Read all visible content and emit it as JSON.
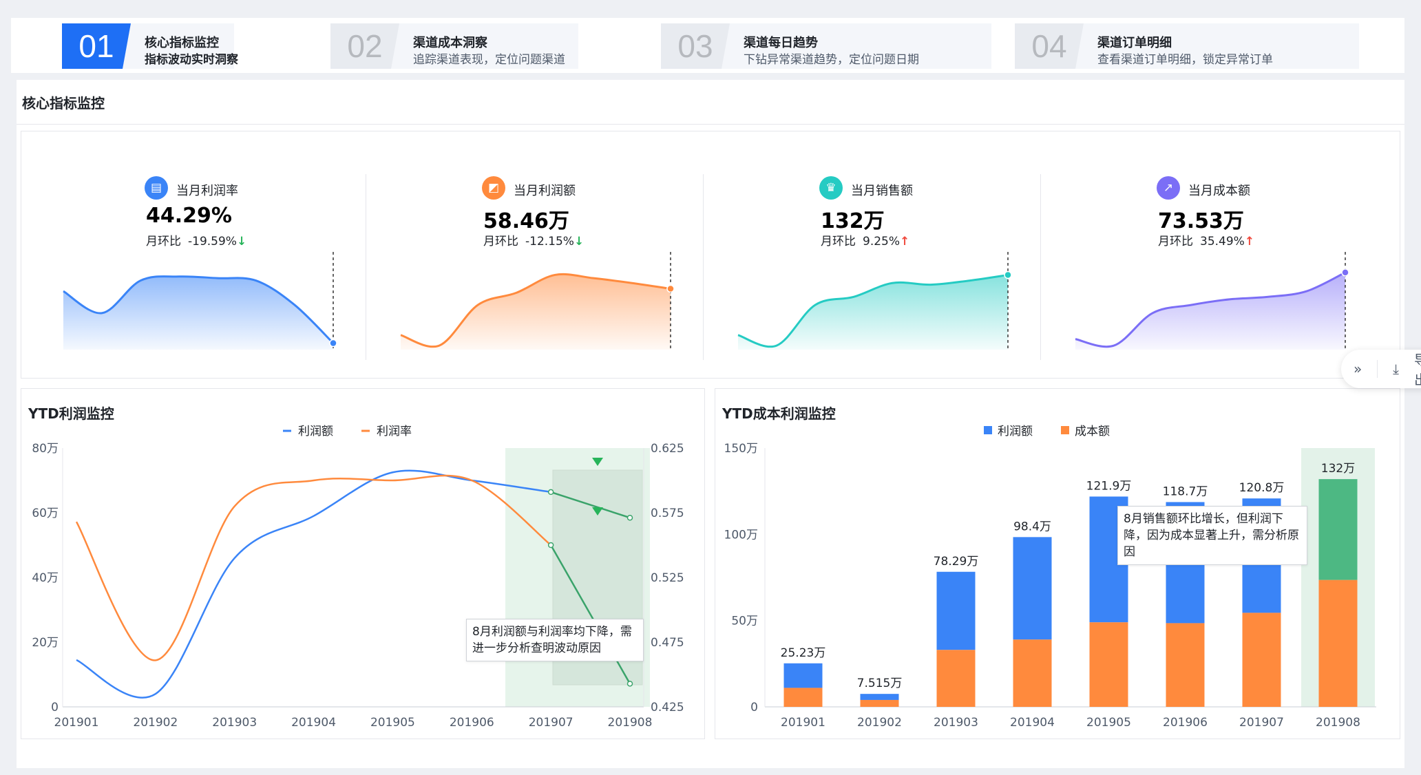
{
  "steps": [
    {
      "num": "01",
      "title": "核心指标监控",
      "desc": "指标波动实时洞察"
    },
    {
      "num": "02",
      "title": "渠道成本洞察",
      "desc": "追踪渠道表现，定位问题渠道"
    },
    {
      "num": "03",
      "title": "渠道每日趋势",
      "desc": "下钻异常渠道趋势，定位问题日期"
    },
    {
      "num": "04",
      "title": "渠道订单明细",
      "desc": "查看渠道订单明细，锁定异常订单"
    }
  ],
  "panel": {
    "title": "核心指标监控"
  },
  "kpis": [
    {
      "name": "当月利润率",
      "value": "44.29%",
      "cmp_label": "月环比",
      "cmp_value": "-19.59%",
      "trend": "down",
      "color": "#3a84f7",
      "icon": "chart-icon",
      "glyph": "▤"
    },
    {
      "name": "当月利润额",
      "value": "58.46万",
      "cmp_label": "月环比",
      "cmp_value": "-12.15%",
      "trend": "down",
      "color": "#ff8a3d",
      "icon": "wallet-icon",
      "glyph": "◩"
    },
    {
      "name": "当月销售额",
      "value": "132万",
      "cmp_label": "月环比",
      "cmp_value": "9.25%",
      "trend": "up",
      "color": "#25cbc3",
      "icon": "crown-icon",
      "glyph": "♛"
    },
    {
      "name": "当月成本额",
      "value": "73.53万",
      "cmp_label": "月环比",
      "cmp_value": "35.49%",
      "trend": "up",
      "color": "#7b6ef6",
      "icon": "trend-icon",
      "glyph": "↗"
    }
  ],
  "side_tool": {
    "label": "导出"
  },
  "chart_data": [
    {
      "type": "line",
      "title": "YTD利润监控",
      "categories": [
        "201901",
        "201902",
        "201903",
        "201904",
        "201905",
        "201906",
        "201907",
        "201908"
      ],
      "series": [
        {
          "name": "利润额",
          "axis": "left",
          "color": "#3a84f7",
          "values": [
            14.5,
            4,
            46,
            59,
            72.5,
            70,
            66.4,
            58.46
          ]
        },
        {
          "name": "利润率",
          "axis": "right",
          "color": "#ff8a3d",
          "values": [
            0.568,
            0.461,
            0.58,
            0.6,
            0.6,
            0.6,
            0.55,
            0.4429
          ]
        }
      ],
      "y_left": {
        "ticks": [
          "0",
          "20万",
          "40万",
          "60万",
          "80万"
        ],
        "min": 0,
        "max": 80
      },
      "y_right": {
        "ticks": [
          "0.425",
          "0.475",
          "0.525",
          "0.575",
          "0.625"
        ],
        "min": 0.425,
        "max": 0.625
      },
      "annotation": "8月利润额与利润率均下降，需进一步分析查明波动原因"
    },
    {
      "type": "bar",
      "title": "YTD成本利润监控",
      "categories": [
        "201901",
        "201902",
        "201903",
        "201904",
        "201905",
        "201906",
        "201907",
        "201908"
      ],
      "series": [
        {
          "name": "利润额",
          "color": "#3a84f7"
        },
        {
          "name": "成本额",
          "color": "#ff8a3d"
        }
      ],
      "totals": [
        25.23,
        7.515,
        78.29,
        98.4,
        121.9,
        118.7,
        120.8,
        132
      ],
      "total_labels": [
        "25.23万",
        "7.515万",
        "78.29万",
        "98.4万",
        "121.9万",
        "118.7万",
        "120.8万",
        "132万"
      ],
      "cost": [
        11,
        4,
        33,
        39,
        49,
        48.5,
        54.5,
        73.53
      ],
      "y_ticks": [
        "0",
        "50万",
        "100万",
        "150万"
      ],
      "y_max": 150,
      "highlight_color": "#4db883",
      "annotation": "8月销售额环比增长，但利润下降，因为成本显著上升，需分析原因"
    }
  ]
}
